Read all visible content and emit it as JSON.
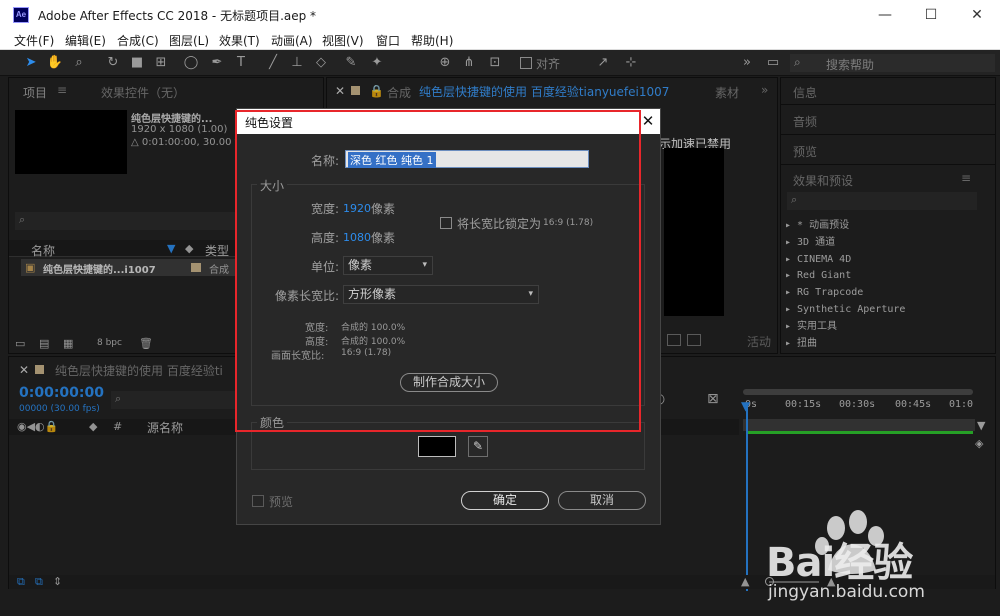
{
  "window": {
    "app_icon": "Ae",
    "title": "Adobe After Effects CC 2018 - 无标题项目.aep *",
    "minimize": "—",
    "maximize": "☐",
    "close": "✕"
  },
  "menu": [
    "文件(F)",
    "编辑(E)",
    "合成(C)",
    "图层(L)",
    "效果(T)",
    "动画(A)",
    "视图(V)",
    "窗口",
    "帮助(H)"
  ],
  "toolbar": {
    "snap_label": "对齐",
    "search_help_placeholder": "搜索帮助",
    "more": "»"
  },
  "project_panel": {
    "tab_project": "项目",
    "tab_effects": "效果控件（无）",
    "item_name": "纯色层快捷键的...",
    "item_size": "1920 x 1080 (1.00)",
    "item_duration": "△ 0:01:00:00, 30.00 fps",
    "col_name": "名称",
    "col_type": "类型",
    "row_name": "纯色层快捷键的...i1007",
    "row_type": "合成",
    "bpc": "8 bpc"
  },
  "comp_panel": {
    "tab_prefix": "合成",
    "tab_name": "纯色层快捷键的使用 百度经验tianyuefei1007",
    "tab_other": "素材",
    "accel_msg": "显示加速已禁用",
    "active_label": "活动"
  },
  "right_panel": {
    "info": "信息",
    "audio": "音频",
    "preview": "预览",
    "effects": "效果和预设",
    "effects_list": [
      "▸ * 动画预设",
      "▸ 3D 通道",
      "▸ CINEMA 4D",
      "▸ Red Giant",
      "▸ RG Trapcode",
      "▸ Synthetic Aperture",
      "▸ 实用工具",
      "▸ 扭曲"
    ]
  },
  "timeline": {
    "tab_name": "纯色层快捷键的使用 百度经验ti",
    "timecode": "0:00:00:00",
    "frame": "00000 (30.00 fps)",
    "col_hash": "#",
    "col_source": "源名称",
    "ruler": [
      "0s",
      "00:15s",
      "00:30s",
      "00:45s",
      "01:0"
    ]
  },
  "dialog": {
    "title": "纯色设置",
    "close": "✕",
    "name_label": "名称:",
    "name_value": "深色 红色 纯色 1",
    "size_group": "大小",
    "width_label": "宽度:",
    "width_value": "1920",
    "width_unit": "像素",
    "height_label": "高度:",
    "height_value": "1080",
    "height_unit": "像素",
    "lock_label": "将长宽比锁定为",
    "lock_ratio": "16:9 (1.78)",
    "units_label": "单位:",
    "units_value": "像素",
    "pixel_aspect_label": "像素长宽比:",
    "pixel_aspect_value": "方形像素",
    "info_width_label": "宽度:",
    "info_width_value": "合成的 100.0%",
    "info_height_label": "高度:",
    "info_height_value": "合成的 100.0%",
    "info_frame_label": "画面长宽比:",
    "info_frame_value": "16:9 (1.78)",
    "make_comp_size": "制作合成大小",
    "color_group": "颜色",
    "color_value": "#000000",
    "preview_label": "预览",
    "ok": "确定",
    "cancel": "取消"
  },
  "watermark": {
    "brand": "Bai经验",
    "url": "jingyan.baidu.com"
  },
  "colors": {
    "highlight_red": "#e8262b",
    "accent_blue": "#2d8ceb",
    "timeline_green": "#2fc42f"
  }
}
